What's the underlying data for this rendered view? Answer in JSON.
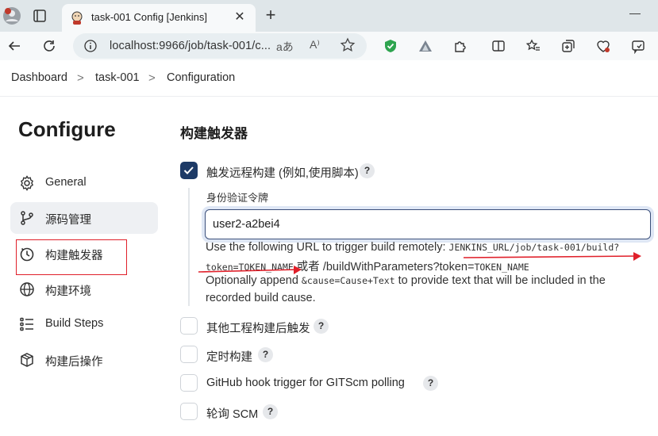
{
  "browser": {
    "tab_title": "task-001 Config [Jenkins]",
    "url": "localhost:9966/job/task-001/c...",
    "read_aloud_label": "aあ",
    "aloud_label": "A⁾"
  },
  "breadcrumb": {
    "items": [
      "Dashboard",
      "task-001",
      "Configuration"
    ],
    "separator": ">"
  },
  "sidebar": {
    "title": "Configure",
    "items": [
      {
        "label": "General",
        "icon": "gear-icon"
      },
      {
        "label": "源码管理",
        "icon": "branch-icon"
      },
      {
        "label": "构建触发器",
        "icon": "clock-icon"
      },
      {
        "label": "构建环境",
        "icon": "globe-icon"
      },
      {
        "label": "Build Steps",
        "icon": "list-icon"
      },
      {
        "label": "构建后操作",
        "icon": "package-icon"
      }
    ]
  },
  "main": {
    "section_title": "构建触发器",
    "remote": {
      "label": "触发远程构建 (例如,使用脚本)",
      "checked": true,
      "field_label": "身份验证令牌",
      "token_value": "user2-a2bei4",
      "desc_line1_pre": "Use the following URL to trigger build remotely: ",
      "desc_line1_code": "JENKINS_URL/job/task-001/build?",
      "desc_line2_code1": "token=TOKEN_NAME",
      "desc_line2_mid": " 或者 /buildWithParameters?token=",
      "desc_line2_code2": "TOKEN_NAME",
      "desc_line3_pre": "Optionally append ",
      "desc_line3_code": "&cause=Cause+Text",
      "desc_line3_post": " to provide text that will be included in the",
      "desc_line4": "recorded build cause."
    },
    "triggers": [
      {
        "label": "其他工程构建后触发",
        "checked": false
      },
      {
        "label": "定时构建",
        "checked": false
      },
      {
        "label": "GitHub hook trigger for GITScm polling",
        "checked": false
      },
      {
        "label": "轮询 SCM",
        "checked": false
      }
    ],
    "help_glyph": "?"
  },
  "colors": {
    "accent": "#1d3a66",
    "highlight": "#e0202a"
  }
}
